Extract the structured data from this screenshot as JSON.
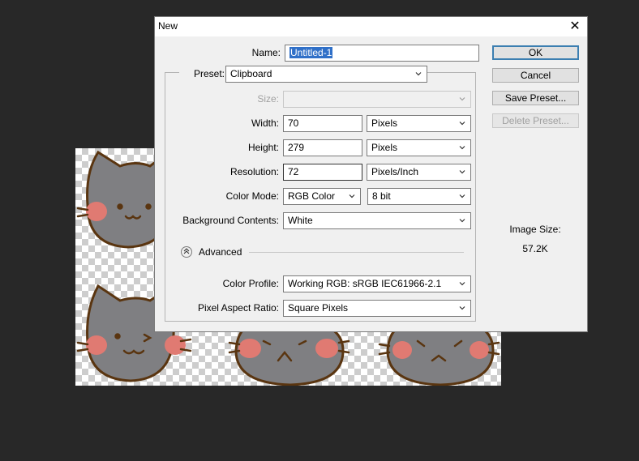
{
  "dialog": {
    "title": "New",
    "close_glyph": "✕"
  },
  "form": {
    "name_label": "Name:",
    "name_value": "Untitled-1",
    "preset_label": "Preset:",
    "preset_value": "Clipboard",
    "size_label": "Size:",
    "size_value": "",
    "width_label": "Width:",
    "width_value": "70",
    "width_unit": "Pixels",
    "height_label": "Height:",
    "height_value": "279",
    "height_unit": "Pixels",
    "resolution_label": "Resolution:",
    "resolution_value": "72",
    "resolution_unit": "Pixels/Inch",
    "color_mode_label": "Color Mode:",
    "color_mode_value": "RGB Color",
    "bit_depth_value": "8 bit",
    "background_label": "Background Contents:",
    "background_value": "White",
    "advanced_label": "Advanced",
    "color_profile_label": "Color Profile:",
    "color_profile_value": "Working RGB:  sRGB IEC61966-2.1",
    "pixel_aspect_label": "Pixel Aspect Ratio:",
    "pixel_aspect_value": "Square Pixels"
  },
  "buttons": {
    "ok": "OK",
    "cancel": "Cancel",
    "save_preset": "Save Preset...",
    "delete_preset": "Delete Preset..."
  },
  "image_size": {
    "label": "Image Size:",
    "value": "57.2K"
  },
  "colors": {
    "workspace_bg": "#282828",
    "dialog_bg": "#f0f0f0",
    "selection": "#3070c8",
    "cat_fill": "#7f7f82",
    "cat_outline": "#5a3510",
    "cheek": "#e07a72"
  }
}
